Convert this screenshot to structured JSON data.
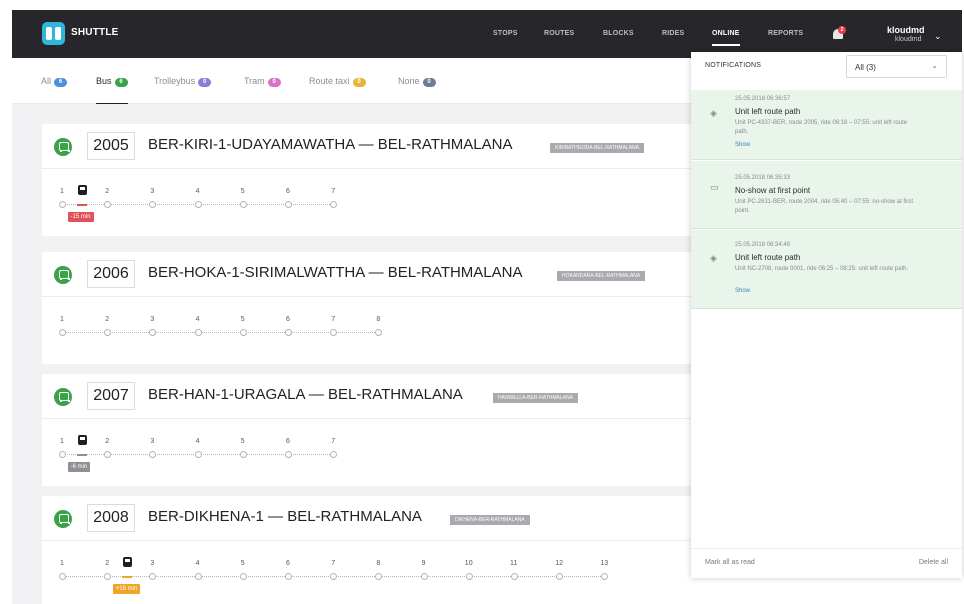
{
  "app": {
    "brand": "SHUTTLE"
  },
  "nav": {
    "items": [
      "STOPS",
      "ROUTES",
      "BLOCKS",
      "RIDES",
      "ONLINE",
      "REPORTS"
    ],
    "active": "ONLINE"
  },
  "notifications_badge": "2",
  "user": {
    "name": "kloudmd",
    "sub": "kloudmd"
  },
  "filters": [
    {
      "label": "All",
      "count": "6",
      "color": "#4a8fe0",
      "active": false
    },
    {
      "label": "Bus",
      "count": "6",
      "color": "#3aa34a",
      "active": true
    },
    {
      "label": "Trolleybus",
      "count": "0",
      "color": "#8a7fd8",
      "active": false
    },
    {
      "label": "Tram",
      "count": "0",
      "color": "#d872c8",
      "active": false
    },
    {
      "label": "Route taxi",
      "count": "0",
      "color": "#e8b433",
      "active": false
    },
    {
      "label": "None",
      "count": "0",
      "color": "#6f7c95",
      "active": false
    }
  ],
  "routes": [
    {
      "number": "2005",
      "name": "BER-KIRI-1-UDAYAMAWATHA — BEL-RATHMALANA",
      "tag": "KIRIBATHGODA-BEL-RATHMALANA",
      "stops": [
        "1",
        "2",
        "3",
        "4",
        "5",
        "6",
        "7"
      ],
      "bus_after_stop": 1,
      "delay": "-15 min",
      "delay_color": "#e2505a"
    },
    {
      "number": "2006",
      "name": "BER-HOKA-1-SIRIMALWATTHA — BEL-RATHMALANA",
      "tag": "HOKANDARA-BEL-RATHMALANA",
      "stops": [
        "1",
        "2",
        "3",
        "4",
        "5",
        "6",
        "7",
        "8"
      ]
    },
    {
      "number": "2007",
      "name": "BER-HAN-1-URAGALA — BEL-RATHMALANA",
      "tag": "HANWELLA-BER-RATHMALANA",
      "stops": [
        "1",
        "2",
        "3",
        "4",
        "5",
        "6",
        "7"
      ],
      "bus_after_stop": 1,
      "delay": "-6 min",
      "delay_color": "#8f8f95"
    },
    {
      "number": "2008",
      "name": "BER-DIKHENA-1 — BEL-RATHMALANA",
      "tag": "DIKHENA-BER-RATHMALANA",
      "stops": [
        "1",
        "2",
        "3",
        "4",
        "5",
        "6",
        "7",
        "8",
        "9",
        "10",
        "11",
        "12",
        "13"
      ],
      "bus_after_stop": 2,
      "delay": "+16 min",
      "delay_color": "#f0a52a"
    }
  ],
  "notifications": {
    "title": "NOTIFICATIONS",
    "filter_value": "All (3)",
    "items": [
      {
        "time": "25.05.2018 06:36:57",
        "title": "Unit left route path",
        "body": "Unit PC-4337-BER, route 2005, ride 06:18 – 07:55: unit left route path.",
        "link": "Show",
        "icon": "route-diamond-icon"
      },
      {
        "time": "25.05.2018 06:35:33",
        "title": "No-show at first point",
        "body": "Unit PC-2631-BER, route 2004, ride 05:40 – 07:55: no-show at first point.",
        "link": "",
        "icon": "no-show-icon"
      },
      {
        "time": "25.05.2018 06:34:48",
        "title": "Unit left route path",
        "body": "Unit NC-2708, route 0001, ride 06:25 – 08:25: unit left route path.",
        "link": "Show",
        "icon": "route-diamond-icon"
      }
    ],
    "mark_all": "Mark all as read",
    "delete_all": "Delete all"
  }
}
